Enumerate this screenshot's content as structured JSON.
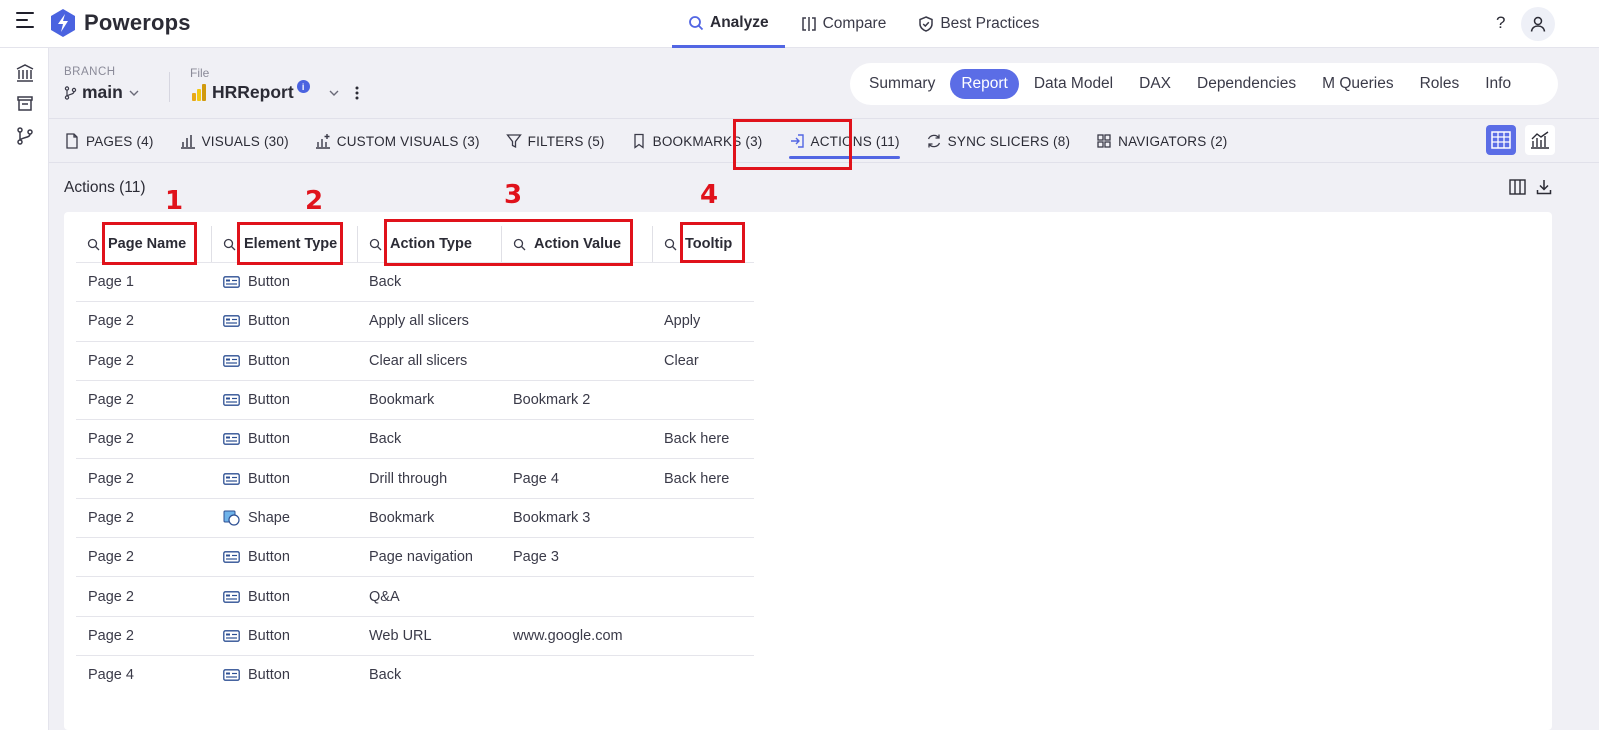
{
  "app": {
    "name": "Powerops",
    "help": "?"
  },
  "top_nav": [
    {
      "label": "Analyze",
      "icon": "search-icon",
      "active": true
    },
    {
      "label": "Compare",
      "icon": "compare-icon",
      "active": false
    },
    {
      "label": "Best Practices",
      "icon": "shield-check-icon",
      "active": false
    }
  ],
  "branch": {
    "label": "BRANCH",
    "value": "main"
  },
  "file": {
    "label": "File",
    "value": "HRReport",
    "info": "i"
  },
  "view_tabs": [
    "Summary",
    "Report",
    "Data Model",
    "DAX",
    "Dependencies",
    "M Queries",
    "Roles",
    "Info"
  ],
  "view_tabs_active": "Report",
  "sub_tabs": [
    {
      "label": "PAGES (4)",
      "icon": "page-icon"
    },
    {
      "label": "VISUALS (30)",
      "icon": "bar-chart-icon"
    },
    {
      "label": "CUSTOM VISUALS (3)",
      "icon": "custom-visual-icon"
    },
    {
      "label": "FILTERS (5)",
      "icon": "filter-icon"
    },
    {
      "label": "BOOKMARKS (3)",
      "icon": "bookmark-icon"
    },
    {
      "label": "ACTIONS (11)",
      "icon": "action-icon",
      "active": true
    },
    {
      "label": "SYNC SLICERS (8)",
      "icon": "sync-icon"
    },
    {
      "label": "NAVIGATORS (2)",
      "icon": "grid-icon"
    }
  ],
  "section_title": "Actions (11)",
  "columns": [
    "Page Name",
    "Element Type",
    "Action Type",
    "Action Value",
    "Tooltip"
  ],
  "rows": [
    {
      "page": "Page 1",
      "element": "Button",
      "action_type": "Back",
      "action_value": "",
      "tooltip": ""
    },
    {
      "page": "Page 2",
      "element": "Button",
      "action_type": "Apply all slicers",
      "action_value": "",
      "tooltip": "Apply"
    },
    {
      "page": "Page 2",
      "element": "Button",
      "action_type": "Clear all slicers",
      "action_value": "",
      "tooltip": "Clear"
    },
    {
      "page": "Page 2",
      "element": "Button",
      "action_type": "Bookmark",
      "action_value": "Bookmark 2",
      "tooltip": ""
    },
    {
      "page": "Page 2",
      "element": "Button",
      "action_type": "Back",
      "action_value": "",
      "tooltip": "Back here"
    },
    {
      "page": "Page 2",
      "element": "Button",
      "action_type": "Drill through",
      "action_value": "Page 4",
      "tooltip": "Back here"
    },
    {
      "page": "Page 2",
      "element": "Shape",
      "action_type": "Bookmark",
      "action_value": "Bookmark 3",
      "tooltip": ""
    },
    {
      "page": "Page 2",
      "element": "Button",
      "action_type": "Page navigation",
      "action_value": "Page 3",
      "tooltip": ""
    },
    {
      "page": "Page 2",
      "element": "Button",
      "action_type": "Q&A",
      "action_value": "",
      "tooltip": ""
    },
    {
      "page": "Page 2",
      "element": "Button",
      "action_type": "Web URL",
      "action_value": "www.google.com",
      "tooltip": ""
    },
    {
      "page": "Page 4",
      "element": "Button",
      "action_type": "Back",
      "action_value": "",
      "tooltip": ""
    }
  ],
  "annotations": [
    "1",
    "2",
    "3",
    "4"
  ],
  "colors": {
    "accent": "#5266e3",
    "annotation": "#e0121b"
  }
}
